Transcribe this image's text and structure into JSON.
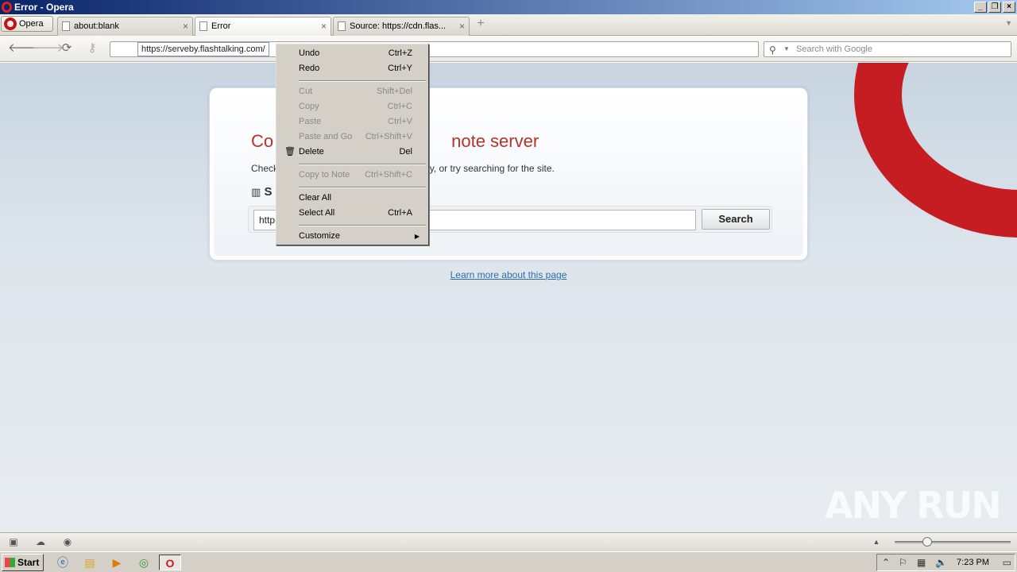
{
  "window": {
    "title": "Error - Opera"
  },
  "opera_menu": {
    "label": "Opera"
  },
  "tabs": [
    {
      "title": "about:blank",
      "close": "×"
    },
    {
      "title": "Error",
      "close": "×"
    },
    {
      "title": "Source: https://cdn.flas...",
      "close": "×"
    }
  ],
  "addressbar": {
    "url": "https://serveby.flashtalking.com/",
    "search_placeholder": "Search with Google"
  },
  "error_page": {
    "title_left": "Co",
    "title_right": "note server",
    "desc_left": "Check",
    "desc_right": "ectly, or try searching for the site.",
    "sub_left": "S",
    "search_value": "http",
    "search_button": "Search",
    "learn_more": "Learn more about this page"
  },
  "context_menu": {
    "items": [
      {
        "label": "Undo",
        "shortcut": "Ctrl+Z",
        "enabled": true
      },
      {
        "label": "Redo",
        "shortcut": "Ctrl+Y",
        "enabled": true
      },
      {
        "label": "Cut",
        "shortcut": "Shift+Del",
        "enabled": false
      },
      {
        "label": "Copy",
        "shortcut": "Ctrl+C",
        "enabled": false
      },
      {
        "label": "Paste",
        "shortcut": "Ctrl+V",
        "enabled": false
      },
      {
        "label": "Paste and Go",
        "shortcut": "Ctrl+Shift+V",
        "enabled": false
      },
      {
        "label": "Delete",
        "shortcut": "Del",
        "enabled": true
      },
      {
        "label": "Copy to Note",
        "shortcut": "Ctrl+Shift+C",
        "enabled": false
      },
      {
        "label": "Clear All",
        "shortcut": "",
        "enabled": true
      },
      {
        "label": "Select All",
        "shortcut": "Ctrl+A",
        "enabled": true
      },
      {
        "label": "Customize",
        "shortcut": "",
        "enabled": true
      }
    ]
  },
  "watermark": "ANY RUN",
  "taskbar": {
    "start_label": "Start",
    "clock": "7:23 PM"
  },
  "colors": {
    "error_title": "#b5332b",
    "link": "#2e6ea8",
    "opera_red": "#c61d23"
  }
}
